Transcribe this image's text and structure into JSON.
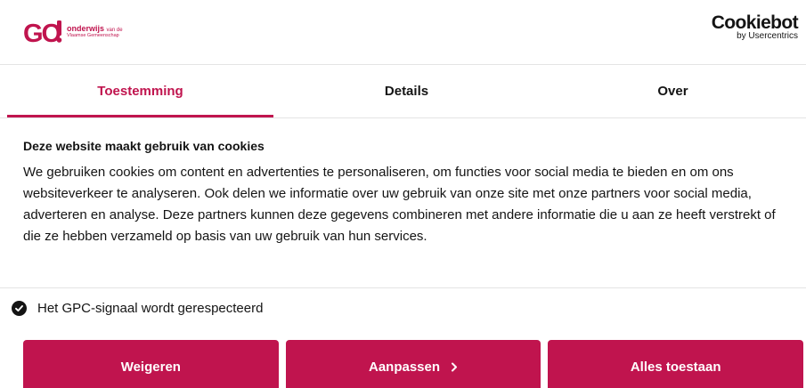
{
  "brand": {
    "logo_line1": "onderwijs",
    "logo_line1_suffix": "van de",
    "logo_line2": "Vlaamse Gemeenschap",
    "accent_color": "#c0144e"
  },
  "provider": {
    "name": "Cookiebot",
    "byline": "by Usercentrics"
  },
  "tabs": [
    {
      "label": "Toestemming",
      "active": true
    },
    {
      "label": "Details",
      "active": false
    },
    {
      "label": "Over",
      "active": false
    }
  ],
  "consent": {
    "heading": "Deze website maakt gebruik van cookies",
    "body": "We gebruiken cookies om content en advertenties te personaliseren, om functies voor social media te bieden en om ons websiteverkeer te analyseren. Ook delen we informatie over uw gebruik van onze site met onze partners voor social media, adverteren en analyse. Deze partners kunnen deze gegevens combineren met andere informatie die u aan ze heeft verstrekt of die ze hebben verzameld op basis van uw gebruik van hun services."
  },
  "gpc": {
    "label": "Het GPC-signaal wordt gerespecteerd",
    "icon": "check-circle-icon"
  },
  "buttons": {
    "deny": "Weigeren",
    "customize": "Aanpassen",
    "allow_all": "Alles toestaan"
  }
}
